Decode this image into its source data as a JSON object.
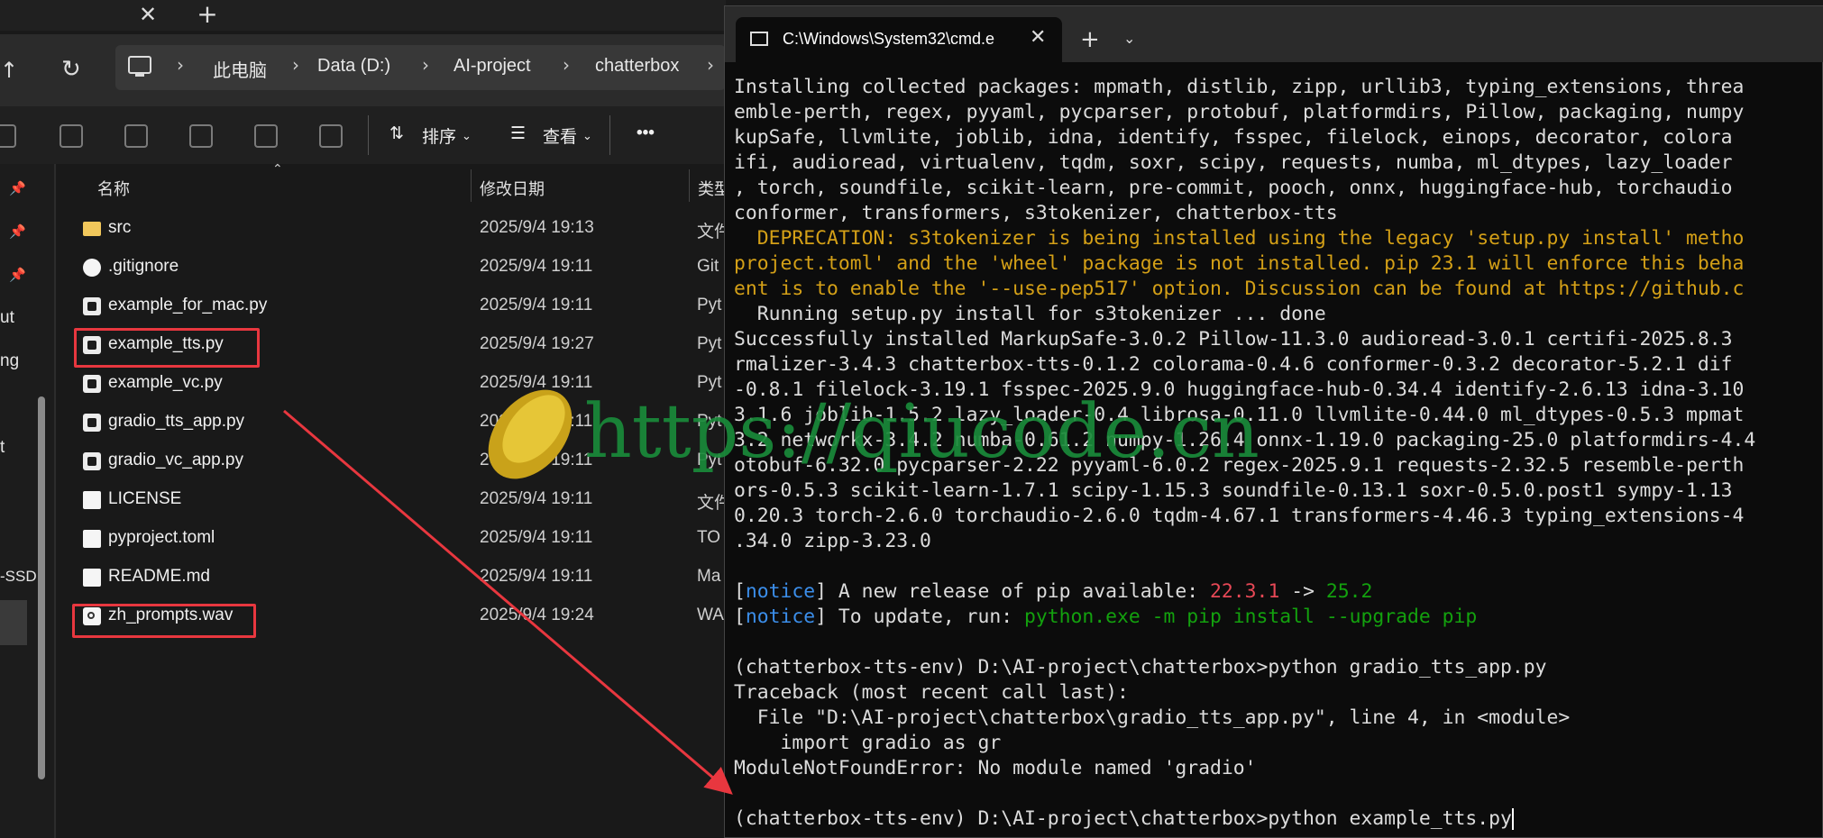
{
  "explorer": {
    "address": [
      "此电脑",
      "Data (D:)",
      "AI-project",
      "chatterbox"
    ],
    "toolbar": {
      "sort_label": "排序",
      "view_label": "查看",
      "more_label": "•••"
    },
    "sidebar_labels": [
      "ut",
      "ng",
      "t",
      "-SSD"
    ],
    "columns": {
      "name": "名称",
      "date": "修改日期",
      "type": "类型"
    },
    "files": [
      {
        "name": "src",
        "date": "2025/9/4 19:13",
        "type": "文件",
        "icon": "folder-icon"
      },
      {
        "name": ".gitignore",
        "date": "2025/9/4 19:11",
        "type": "Git",
        "icon": "gear-file-icon"
      },
      {
        "name": "example_for_mac.py",
        "date": "2025/9/4 19:11",
        "type": "Pyt",
        "icon": "python-file-icon"
      },
      {
        "name": "example_tts.py",
        "date": "2025/9/4 19:27",
        "type": "Pyt",
        "icon": "python-file-icon"
      },
      {
        "name": "example_vc.py",
        "date": "2025/9/4 19:11",
        "type": "Pyt",
        "icon": "python-file-icon"
      },
      {
        "name": "gradio_tts_app.py",
        "date": "2025/9/4 19:11",
        "type": "Pyt",
        "icon": "python-file-icon"
      },
      {
        "name": "gradio_vc_app.py",
        "date": "2025/9/4 19:11",
        "type": "Pyt",
        "icon": "python-file-icon"
      },
      {
        "name": "LICENSE",
        "date": "2025/9/4 19:11",
        "type": "文件",
        "icon": "document-icon"
      },
      {
        "name": "pyproject.toml",
        "date": "2025/9/4 19:11",
        "type": "TO",
        "icon": "document-icon"
      },
      {
        "name": "README.md",
        "date": "2025/9/4 19:11",
        "type": "Ma",
        "icon": "document-icon"
      },
      {
        "name": "zh_prompts.wav",
        "date": "2025/9/4 19:24",
        "type": "WA",
        "icon": "audio-file-icon"
      }
    ]
  },
  "terminal": {
    "tab_title": "C:\\Windows\\System32\\cmd.e",
    "lines": [
      [
        {
          "t": "Installing collected packages: mpmath, distlib, zipp, urllib3, typing_extensions, threa"
        }
      ],
      [
        {
          "t": "emble-perth, regex, pyyaml, pycparser, protobuf, platformdirs, Pillow, packaging, numpy"
        }
      ],
      [
        {
          "t": "kupSafe, llvmlite, joblib, idna, identify, fsspec, filelock, einops, decorator, colora"
        }
      ],
      [
        {
          "t": "ifi, audioread, virtualenv, tqdm, soxr, scipy, requests, numba, ml_dtypes, lazy_loader"
        }
      ],
      [
        {
          "t": ", torch, soundfile, scikit-learn, pre-commit, pooch, onnx, huggingface-hub, torchaudio"
        }
      ],
      [
        {
          "t": "conformer, transformers, s3tokenizer, chatterbox-tts"
        }
      ],
      [
        {
          "t": "  DEPRECATION: s3tokenizer is being installed using the legacy 'setup.py install' metho",
          "c": "warn"
        }
      ],
      [
        {
          "t": "project.toml' and the 'wheel' package is not installed. pip 23.1 will enforce this beha",
          "c": "warn"
        }
      ],
      [
        {
          "t": "ent is to enable the '--use-pep517' option. Discussion can be found at https://github.c",
          "c": "warn"
        }
      ],
      [
        {
          "t": "  Running setup.py install for s3tokenizer ... done"
        }
      ],
      [
        {
          "t": "Successfully installed MarkupSafe-3.0.2 Pillow-11.3.0 audioread-3.0.1 certifi-2025.8.3"
        }
      ],
      [
        {
          "t": "rmalizer-3.4.3 chatterbox-tts-0.1.2 colorama-0.4.6 conformer-0.3.2 decorator-5.2.1 dif"
        }
      ],
      [
        {
          "t": "-0.8.1 filelock-3.19.1 fsspec-2025.9.0 huggingface-hub-0.34.4 identify-2.6.13 idna-3.10"
        }
      ],
      [
        {
          "t": "3.1.6 joblib-1.5.2 lazy_loader-0.4 librosa-0.11.0 llvmlite-0.44.0 ml_dtypes-0.5.3 mpmat"
        }
      ],
      [
        {
          "t": "3.2 networkx-3.4.2 numba-0.61.2 numpy-1.26.4 onnx-1.19.0 packaging-25.0 platformdirs-4.4"
        }
      ],
      [
        {
          "t": "otobuf-6.32.0 pycparser-2.22 pyyaml-6.0.2 regex-2025.9.1 requests-2.32.5 resemble-perth"
        }
      ],
      [
        {
          "t": "ors-0.5.3 scikit-learn-1.7.1 scipy-1.15.3 soundfile-0.13.1 soxr-0.5.0.post1 sympy-1.13"
        }
      ],
      [
        {
          "t": "0.20.3 torch-2.6.0 torchaudio-2.6.0 tqdm-4.67.1 transformers-4.46.3 typing_extensions-4"
        }
      ],
      [
        {
          "t": ".34.0 zipp-3.23.0"
        }
      ],
      [
        {
          "t": ""
        }
      ],
      [
        {
          "t": "["
        },
        {
          "t": "notice",
          "c": "blue"
        },
        {
          "t": "] A new release of pip available: "
        },
        {
          "t": "22.3.1",
          "c": "red"
        },
        {
          "t": " -> "
        },
        {
          "t": "25.2",
          "c": "green"
        }
      ],
      [
        {
          "t": "["
        },
        {
          "t": "notice",
          "c": "blue"
        },
        {
          "t": "] To update, run: "
        },
        {
          "t": "python.exe -m pip install --upgrade pip",
          "c": "green"
        }
      ],
      [
        {
          "t": ""
        }
      ],
      [
        {
          "t": "(chatterbox-tts-env) D:\\AI-project\\chatterbox>python gradio_tts_app.py"
        }
      ],
      [
        {
          "t": "Traceback (most recent call last):"
        }
      ],
      [
        {
          "t": "  File \"D:\\AI-project\\chatterbox\\gradio_tts_app.py\", line 4, in <module>"
        }
      ],
      [
        {
          "t": "    import gradio as gr"
        }
      ],
      [
        {
          "t": "ModuleNotFoundError: No module named 'gradio'"
        }
      ],
      [
        {
          "t": ""
        }
      ],
      [
        {
          "t": "(chatterbox-tts-env) D:\\AI-project\\chatterbox>python example_tts.py"
        }
      ]
    ]
  },
  "watermark": "https://qiucode.cn",
  "colors": {
    "highlight": "#e8373f",
    "warning": "#d4a017",
    "notice": "#3b8eea",
    "green": "#13a10e"
  }
}
